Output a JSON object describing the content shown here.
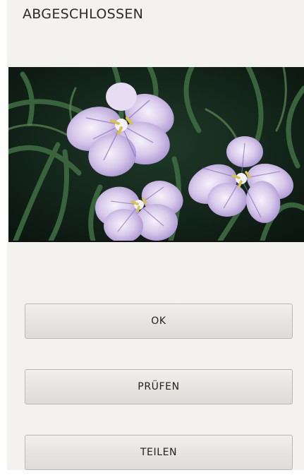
{
  "screen": {
    "title": "ABGESCHLOSSEN"
  },
  "preview": {
    "subject": "iris-flowers-photo"
  },
  "actions": {
    "ok_label": "OK",
    "check_label": "PRÜFEN",
    "share_label": "TEILEN"
  },
  "colors": {
    "background": "#f4f2ee",
    "button_top": "#f0efec",
    "button_bottom": "#dddcd8",
    "flower_petal": "#d9cbe9",
    "flower_vein": "#8d76bf",
    "leaf": "#2f5a36"
  }
}
